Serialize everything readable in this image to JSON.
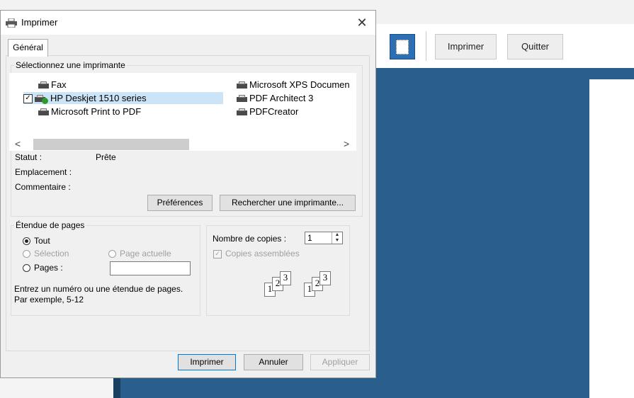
{
  "toolbar": {
    "print_label": "Imprimer",
    "quit_label": "Quitter"
  },
  "dialog": {
    "title": "Imprimer",
    "close_glyph": "✕",
    "tab_general": "Général",
    "printer_group_title": "Sélectionnez une imprimante",
    "printers": [
      {
        "name": "Fax"
      },
      {
        "name": "HP Deskjet 1510 series",
        "selected": true
      },
      {
        "name": "Microsoft Print to PDF"
      },
      {
        "name": "Microsoft XPS Documen"
      },
      {
        "name": "PDF Architect 3"
      },
      {
        "name": "PDFCreator"
      }
    ],
    "scroll_left": "<",
    "scroll_right": ">",
    "status_label": "Statut :",
    "status_value": "Prête",
    "location_label": "Emplacement :",
    "comment_label": "Commentaire :",
    "preferences_button": "Préférences",
    "find_printer_button": "Rechercher une imprimante...",
    "page_range": {
      "title": "Étendue de pages",
      "all": "Tout",
      "selection": "Sélection",
      "current_page": "Page actuelle",
      "pages": "Pages :",
      "pages_value": "",
      "hint_line1": "Entrez un numéro ou une étendue de pages.",
      "hint_line2": "Par exemple, 5-12"
    },
    "copies": {
      "label": "Nombre de copies :",
      "value": "1",
      "collate_label": "Copies assemblées",
      "collate_checked": true
    },
    "footer": {
      "print_button": "Imprimer",
      "cancel_button": "Annuler",
      "apply_button": "Appliquer"
    }
  },
  "icons": [
    "printer-icon",
    "close-icon",
    "page-layout-icon",
    "collate-icon"
  ],
  "colors": {
    "workspace_blue": "#2a5e8c",
    "selection": "#cce4f7",
    "default_button_border": "#0078d7"
  }
}
